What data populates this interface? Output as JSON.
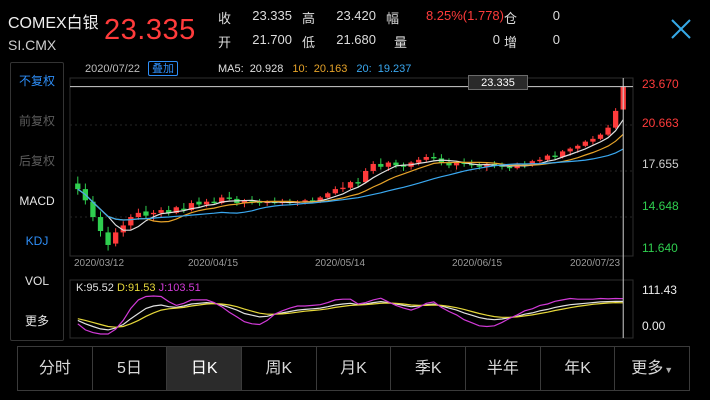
{
  "header": {
    "instrument_name": "COMEX白银",
    "instrument_code": "SI.CMX",
    "last_price": "23.335",
    "close_icon": "close-icon"
  },
  "quote": {
    "row1": [
      {
        "label": "收",
        "value": "23.335"
      },
      {
        "label": "高",
        "value": "23.420"
      },
      {
        "label": "幅",
        "value": "8.25%(1.778)"
      },
      {
        "label": "仓",
        "value": "0"
      }
    ],
    "row2": [
      {
        "label": "开",
        "value": "21.700"
      },
      {
        "label": "低",
        "value": "21.680"
      },
      {
        "label": "量",
        "value": "0"
      },
      {
        "label": "增",
        "value": "0"
      }
    ]
  },
  "side_menu": [
    "不复权",
    "前复权",
    "后复权",
    "MACD",
    "KDJ",
    "VOL",
    "更多"
  ],
  "side_menu_active": "不复权",
  "side_menu_disabled": [
    "前复权",
    "后复权"
  ],
  "side_menu_blue": [
    "KDJ"
  ],
  "chart_header": {
    "date": "2020/07/22",
    "add_button": "叠加",
    "ma5_label": "MA5:",
    "ma5_value": "20.928",
    "ma10_label": "10:",
    "ma10_value": "20.163",
    "ma20_label": "20:",
    "ma20_value": "19.237",
    "price_tag": "23.335"
  },
  "kdj_header": {
    "k": "K:95.52",
    "d": "D:91.53",
    "j": "J:103.51"
  },
  "colors": {
    "up": "#ff3b3b",
    "down": "#2fcf4f",
    "ma5": "#e0e0e0",
    "ma10": "#e6a329",
    "ma20": "#3aa8f0",
    "k": "#e0e0e0",
    "d": "#e6d83a",
    "j": "#d23ad8",
    "accent": "#2e8ef7"
  },
  "tabs": [
    "分时",
    "5日",
    "日K",
    "周K",
    "月K",
    "季K",
    "半年",
    "年K",
    "更多"
  ],
  "active_tab": "日K",
  "chart_data": [
    {
      "type": "candlestick",
      "title": "",
      "x_labels": [
        "2020/03/12",
        "2020/04/15",
        "2020/05/14",
        "2020/06/15",
        "2020/07/23"
      ],
      "y_labels": [
        "23.670",
        "20.663",
        "17.655",
        "14.648",
        "11.640"
      ],
      "ylim": [
        11.64,
        23.67
      ],
      "candles": [
        [
          16.4,
          16.9,
          15.6,
          16.0
        ],
        [
          16.0,
          16.4,
          14.9,
          15.2
        ],
        [
          15.1,
          15.5,
          13.7,
          14.0
        ],
        [
          14.0,
          14.4,
          12.6,
          13.0
        ],
        [
          12.9,
          13.3,
          11.6,
          12.0
        ],
        [
          12.1,
          13.2,
          11.9,
          12.9
        ],
        [
          12.9,
          13.7,
          12.6,
          13.4
        ],
        [
          13.4,
          14.2,
          13.1,
          14.0
        ],
        [
          14.0,
          14.6,
          13.8,
          14.3
        ],
        [
          14.4,
          14.8,
          13.9,
          14.1
        ],
        [
          14.2,
          14.5,
          13.7,
          14.3
        ],
        [
          14.3,
          14.7,
          14.0,
          14.5
        ],
        [
          14.5,
          14.8,
          14.1,
          14.3
        ],
        [
          14.3,
          14.8,
          14.2,
          14.7
        ],
        [
          14.6,
          15.0,
          14.3,
          14.5
        ],
        [
          14.5,
          15.2,
          14.4,
          15.0
        ],
        [
          15.1,
          15.4,
          14.7,
          14.9
        ],
        [
          14.9,
          15.3,
          14.7,
          15.1
        ],
        [
          15.1,
          15.4,
          14.9,
          15.0
        ],
        [
          15.0,
          15.6,
          14.9,
          15.4
        ],
        [
          15.4,
          15.8,
          15.2,
          15.3
        ],
        [
          15.3,
          15.5,
          14.8,
          15.0
        ],
        [
          15.0,
          15.3,
          14.7,
          15.2
        ],
        [
          15.2,
          15.5,
          14.9,
          15.1
        ],
        [
          15.1,
          15.3,
          14.8,
          15.0
        ],
        [
          15.0,
          15.2,
          14.8,
          15.1
        ],
        [
          15.1,
          15.4,
          14.9,
          15.0
        ],
        [
          15.0,
          15.3,
          14.8,
          15.1
        ],
        [
          15.1,
          15.3,
          14.9,
          15.0
        ],
        [
          15.0,
          15.2,
          14.8,
          15.1
        ],
        [
          15.1,
          15.3,
          14.9,
          15.2
        ],
        [
          15.2,
          15.4,
          15.0,
          15.1
        ],
        [
          15.1,
          15.5,
          15.0,
          15.4
        ],
        [
          15.4,
          15.8,
          15.3,
          15.7
        ],
        [
          15.7,
          16.2,
          15.6,
          16.0
        ],
        [
          16.0,
          16.5,
          15.8,
          16.1
        ],
        [
          16.1,
          16.6,
          16.0,
          16.5
        ],
        [
          16.5,
          16.8,
          16.1,
          16.4
        ],
        [
          16.5,
          17.5,
          16.4,
          17.3
        ],
        [
          17.3,
          18.0,
          17.1,
          17.8
        ],
        [
          17.8,
          18.2,
          17.4,
          17.6
        ],
        [
          17.6,
          18.0,
          17.3,
          17.9
        ],
        [
          17.9,
          18.1,
          17.5,
          17.7
        ],
        [
          17.7,
          17.9,
          17.3,
          17.6
        ],
        [
          17.6,
          18.0,
          17.4,
          17.9
        ],
        [
          17.9,
          18.3,
          17.7,
          18.1
        ],
        [
          18.1,
          18.5,
          17.9,
          18.3
        ],
        [
          18.3,
          18.6,
          18.0,
          18.2
        ],
        [
          18.2,
          18.5,
          17.7,
          17.9
        ],
        [
          17.9,
          18.2,
          17.5,
          17.7
        ],
        [
          17.7,
          18.0,
          17.4,
          17.9
        ],
        [
          17.9,
          18.2,
          17.6,
          17.8
        ],
        [
          17.8,
          18.1,
          17.5,
          17.7
        ],
        [
          17.7,
          17.9,
          17.4,
          17.6
        ],
        [
          17.6,
          17.9,
          17.3,
          17.8
        ],
        [
          17.8,
          18.0,
          17.5,
          17.7
        ],
        [
          17.7,
          17.9,
          17.4,
          17.6
        ],
        [
          17.6,
          17.8,
          17.3,
          17.5
        ],
        [
          17.5,
          17.9,
          17.4,
          17.8
        ],
        [
          17.8,
          18.0,
          17.5,
          17.7
        ],
        [
          17.7,
          18.1,
          17.6,
          18.0
        ],
        [
          18.0,
          18.3,
          17.8,
          18.1
        ],
        [
          18.1,
          18.5,
          18.0,
          18.4
        ],
        [
          18.4,
          18.7,
          18.1,
          18.3
        ],
        [
          18.3,
          18.8,
          18.2,
          18.7
        ],
        [
          18.7,
          19.0,
          18.4,
          18.9
        ],
        [
          18.9,
          19.2,
          18.6,
          19.1
        ],
        [
          19.1,
          19.5,
          19.0,
          19.4
        ],
        [
          19.4,
          19.8,
          19.2,
          19.6
        ],
        [
          19.6,
          20.0,
          19.5,
          19.9
        ],
        [
          19.9,
          20.6,
          19.8,
          20.4
        ],
        [
          20.4,
          21.8,
          20.3,
          21.6
        ],
        [
          21.7,
          23.4,
          21.68,
          23.335
        ]
      ]
    },
    {
      "type": "line",
      "title": "KDJ",
      "y_labels": [
        "111.43",
        "0.00"
      ],
      "ylim": [
        0,
        111.43
      ],
      "series": [
        {
          "name": "K",
          "values": [
            40,
            30,
            22,
            15,
            12,
            18,
            28,
            45,
            60,
            75,
            82,
            85,
            80,
            78,
            82,
            88,
            90,
            92,
            90,
            85,
            78,
            70,
            60,
            55,
            50,
            52,
            58,
            62,
            66,
            70,
            72,
            74,
            76,
            80,
            85,
            88,
            90,
            86,
            88,
            92,
            95,
            92,
            88,
            84,
            80,
            82,
            86,
            88,
            82,
            76,
            70,
            62,
            55,
            48,
            44,
            42,
            44,
            48,
            52,
            58,
            62,
            68,
            72,
            78,
            82,
            86,
            88,
            90,
            92,
            94,
            95,
            96,
            95.52
          ]
        },
        {
          "name": "D",
          "values": [
            45,
            40,
            34,
            28,
            22,
            20,
            22,
            30,
            40,
            52,
            62,
            70,
            74,
            76,
            78,
            82,
            85,
            88,
            89,
            88,
            85,
            80,
            73,
            67,
            61,
            58,
            58,
            59,
            61,
            64,
            67,
            69,
            71,
            74,
            78,
            81,
            84,
            85,
            86,
            88,
            90,
            91,
            90,
            88,
            85,
            84,
            84,
            85,
            84,
            81,
            77,
            72,
            66,
            60,
            55,
            51,
            49,
            49,
            50,
            53,
            56,
            60,
            64,
            69,
            73,
            77,
            81,
            84,
            87,
            89,
            91,
            92,
            91.53
          ]
        },
        {
          "name": "J",
          "values": [
            30,
            12,
            4,
            0,
            0,
            14,
            40,
            75,
            100,
            110,
            112,
            110,
            95,
            84,
            90,
            100,
            100,
            100,
            92,
            80,
            64,
            50,
            36,
            30,
            28,
            40,
            58,
            68,
            76,
            82,
            82,
            84,
            86,
            92,
            100,
            102,
            102,
            88,
            92,
            100,
            105,
            94,
            84,
            76,
            70,
            78,
            90,
            94,
            78,
            66,
            56,
            42,
            33,
            24,
            22,
            24,
            34,
            46,
            56,
            68,
            74,
            84,
            88,
            96,
            100,
            104,
            102,
            102,
            102,
            104,
            103,
            104,
            103.51
          ]
        }
      ]
    }
  ]
}
